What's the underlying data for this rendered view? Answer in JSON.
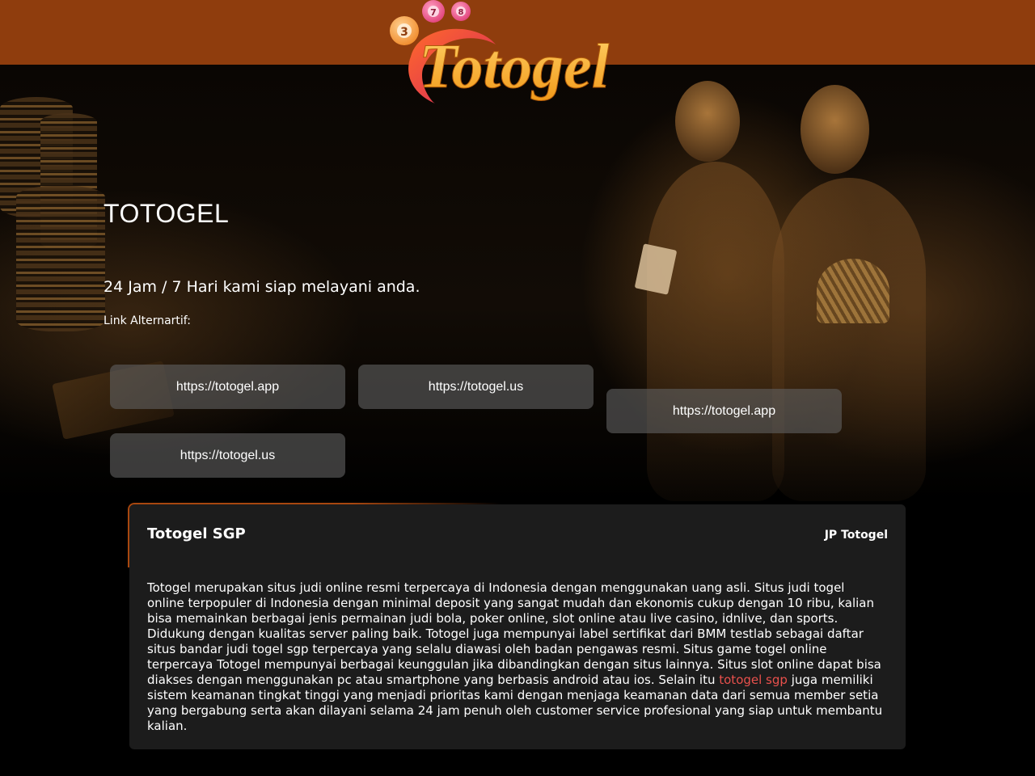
{
  "header": {
    "logo_text": "Totogel",
    "logo_balls": [
      "3",
      "7",
      "8"
    ]
  },
  "hero": {
    "title": "TOTOGEL",
    "tagline": "24 Jam / 7 Hari kami siap melayani anda.",
    "alt_label": "Link Alternartif:",
    "links": [
      {
        "label": "https://totogel.app"
      },
      {
        "label": "https://totogel.us"
      },
      {
        "label": "https://totogel.app"
      },
      {
        "label": "https://totogel.us"
      }
    ]
  },
  "card": {
    "title": "Totogel SGP",
    "tag": "JP Totogel",
    "body_before": "Totogel merupakan situs judi online resmi terpercaya di Indonesia dengan menggunakan uang asli. Situs judi togel online terpopuler di Indonesia dengan minimal deposit yang sangat mudah dan ekonomis cukup dengan 10 ribu, kalian bisa memainkan berbagai jenis permainan judi bola, poker online, slot online atau live casino, idnlive, dan sports. Didukung dengan kualitas server paling baik. Totogel juga mempunyai label sertifikat dari BMM testlab sebagai daftar situs bandar judi togel sgp terpercaya yang selalu diawasi oleh badan pengawas resmi. Situs game togel online terpercaya Totogel mempunyai berbagai keunggulan jika dibandingkan dengan situs lainnya. Situs slot online dapat bisa diakses dengan menggunakan pc atau smartphone yang berbasis android atau ios. Selain itu ",
    "body_link": "totogel sgp",
    "body_after": " juga memiliki sistem keamanan tingkat tinggi yang menjadi prioritas kami dengan menjaga keamanan data dari semua member setia yang bergabung serta akan dilayani selama 24 jam penuh oleh customer service profesional yang siap untuk membantu kalian."
  },
  "colors": {
    "header_bg": "#8f3d0d",
    "card_bg": "#1c1c1c",
    "link_color": "#e8504c",
    "button_bg": "rgba(95,95,95,0.62)"
  }
}
